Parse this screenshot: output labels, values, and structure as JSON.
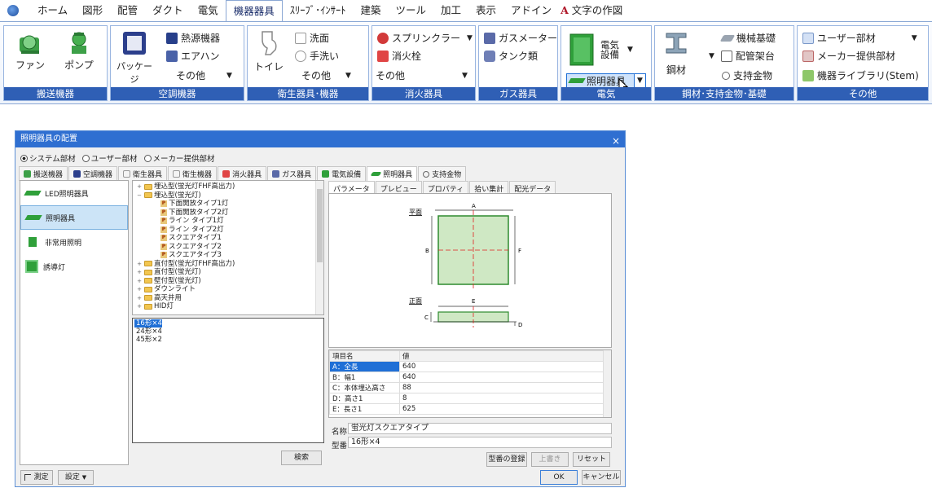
{
  "menu": {
    "items": [
      "ホーム",
      "図形",
      "配管",
      "ダクト",
      "電気",
      "機器器具",
      "ｽﾘｰﾌﾞ･ｲﾝｻｰﾄ",
      "建築",
      "ツール",
      "加工",
      "表示",
      "アドイン",
      "文字の作図"
    ],
    "text_icon_glyph": "A"
  },
  "ribbon": {
    "groups": {
      "fan_pump": {
        "caption": "搬送機器",
        "fan": "ファン",
        "pump": "ポンプ"
      },
      "aircon": {
        "caption": "空調機器",
        "package": "パッケージ",
        "heat_source": "熱源機器",
        "air_handler": "エアハン",
        "other": "その他"
      },
      "sanitary": {
        "caption": "衛生器具･機器",
        "toilet": "トイレ",
        "washbasin": "洗面",
        "handwash": "手洗い",
        "other": "その他"
      },
      "fire": {
        "caption": "消火器具",
        "sprinkler": "スプリンクラー",
        "hydrant": "消火栓",
        "other": "その他"
      },
      "gas": {
        "caption": "ガス器具",
        "gas_meter": "ガスメーター",
        "tank": "タンク類"
      },
      "electric": {
        "caption": "電気",
        "equipment": "電気\n設備",
        "lighting": "照明器具"
      },
      "steel": {
        "caption": "鋼材･支持金物･基礎",
        "steel": "鋼材",
        "machine_base": "機械基礎",
        "pipe_rack": "配管架台",
        "support": "支持金物"
      },
      "others": {
        "caption": "その他",
        "user_parts": "ユーザー部材",
        "maker_parts": "メーカー提供部材",
        "library": "機器ライブラリ(Stem)"
      }
    }
  },
  "dialog": {
    "title": "照明器具の配置",
    "close": "×",
    "radios": {
      "options": [
        "システム部材",
        "ユーザー部材",
        "メーカー提供部材"
      ],
      "selected": "システム部材"
    },
    "category_tabs": [
      "搬送機器",
      "空調機器",
      "衛生器具",
      "衛生機器",
      "消火器具",
      "ガス器具",
      "電気設備",
      "照明器具",
      "支持金物"
    ],
    "active_category": "照明器具",
    "left_list": [
      "LED照明器具",
      "照明器具",
      "非常用照明",
      "誘導灯"
    ],
    "selected_left": "照明器具",
    "tree": [
      {
        "level": 0,
        "label": "埋込型(蛍光灯FHF高出力)",
        "kind": "folder"
      },
      {
        "level": 0,
        "label": "埋込型(蛍光灯)",
        "kind": "folder"
      },
      {
        "level": 1,
        "label": "下面開放タイプ1灯",
        "kind": "part"
      },
      {
        "level": 1,
        "label": "下面開放タイプ2灯",
        "kind": "part"
      },
      {
        "level": 1,
        "label": "ライン タイプ1灯",
        "kind": "part"
      },
      {
        "level": 1,
        "label": "ライン タイプ2灯",
        "kind": "part"
      },
      {
        "level": 1,
        "label": "スクエアタイプ1",
        "kind": "part"
      },
      {
        "level": 1,
        "label": "スクエアタイプ2",
        "kind": "part"
      },
      {
        "level": 1,
        "label": "スクエアタイプ3",
        "kind": "part"
      },
      {
        "level": 0,
        "label": "直付型(蛍光灯FHF高出力)",
        "kind": "folder"
      },
      {
        "level": 0,
        "label": "直付型(蛍光灯)",
        "kind": "folder"
      },
      {
        "level": 0,
        "label": "壁付型(蛍光灯)",
        "kind": "folder"
      },
      {
        "level": 0,
        "label": "ダウンライト",
        "kind": "folder"
      },
      {
        "level": 0,
        "label": "高天井用",
        "kind": "folder"
      },
      {
        "level": 0,
        "label": "HID灯",
        "kind": "folder"
      }
    ],
    "model_list": [
      "16形×4",
      "24形×4",
      "45形×2"
    ],
    "selected_model": "16形×4",
    "search_button": "検索",
    "preview_tabs": [
      "パラメータ",
      "プレビュー",
      "プロパティ",
      "拾い集計",
      "配光データ"
    ],
    "active_preview_tab": "パラメータ",
    "drawing": {
      "plan_label": "平面",
      "front_label": "正面",
      "dims": [
        "A",
        "B",
        "F",
        "C",
        "E",
        "D"
      ]
    },
    "param_table": {
      "headers": [
        "項目名",
        "値"
      ],
      "rows": [
        {
          "name": "A：全長",
          "value": "640"
        },
        {
          "name": "B：幅1",
          "value": "640"
        },
        {
          "name": "C：本体埋込高さ",
          "value": "88"
        },
        {
          "name": "D：高さ1",
          "value": "8"
        },
        {
          "name": "E：長さ1",
          "value": "625"
        }
      ]
    },
    "name_label": "名称",
    "name_value": "蛍光灯スクエアタイプ",
    "model_label": "型番",
    "model_value": "16形×4",
    "register_button": "型番の登録",
    "overwrite_button": "上書き",
    "reset_button": "リセット",
    "measure_button": "測定",
    "settings_button": "設定",
    "ok_button": "OK",
    "cancel_button": "キャンセル"
  },
  "colors": {
    "accent": "#2f5fb5",
    "title_bar": "#2f6fd1",
    "selection": "#1f6fd6",
    "lamp_green": "#2fa03a"
  }
}
